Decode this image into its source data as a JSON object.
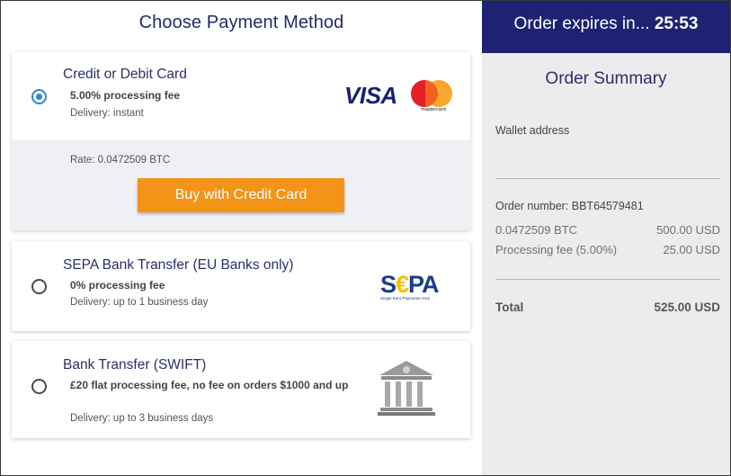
{
  "page": {
    "title": "Choose Payment Method"
  },
  "options": [
    {
      "title": "Credit or Debit Card",
      "fee": "5.00% processing fee",
      "delivery": "Delivery: instant",
      "selected": true,
      "rate": "Rate: 0.0472509 BTC",
      "button_label": "Buy with Credit Card",
      "logos": {
        "visa": "VISA",
        "mastercard": "mastercard"
      }
    },
    {
      "title": "SEPA Bank Transfer (EU Banks only)",
      "fee": "0% processing fee",
      "delivery": "Delivery: up to 1 business day",
      "selected": false,
      "logo": {
        "s": "S",
        "euro": "€",
        "pa": "PA",
        "tagline": "Single Euro Payments Area"
      }
    },
    {
      "title": "Bank Transfer (SWIFT)",
      "fee": "£20 flat processing fee, no fee on orders $1000 and up",
      "delivery": "Delivery: up to 3 business days",
      "selected": false,
      "logo_icon": "bank-building-icon"
    }
  ],
  "summary": {
    "expires_label": "Order expires in...",
    "expires_time": "25:53",
    "title": "Order Summary",
    "wallet_label": "Wallet address",
    "wallet_value": "",
    "order_number": "Order number: BBT64579481",
    "lines": [
      {
        "label": "0.0472509 BTC",
        "value": "500.00 USD"
      },
      {
        "label": "Processing fee (5.00%)",
        "value": "25.00 USD"
      }
    ],
    "total_label": "Total",
    "total_value": "525.00 USD"
  },
  "colors": {
    "navy": "#1e2273",
    "accent_orange": "#f39318",
    "radio_blue": "#2a8ad4",
    "summary_bg": "#ececee"
  }
}
